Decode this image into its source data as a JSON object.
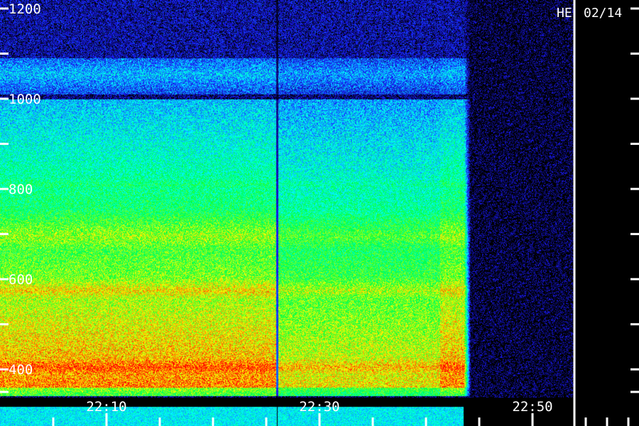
{
  "chart_data": {
    "type": "heatmap",
    "title": "",
    "station_label": "HE",
    "date_label": "02/14",
    "xlabel": "",
    "ylabel": "",
    "y_range": [
      350,
      1200
    ],
    "y_tick_labels": [
      {
        "value": 1200,
        "label": "1200"
      },
      {
        "value": 1000,
        "label": "1000"
      },
      {
        "value": 800,
        "label": "800"
      },
      {
        "value": 600,
        "label": "600"
      },
      {
        "value": 400,
        "label": "400"
      }
    ],
    "y_minor_ticks": [
      1100,
      900,
      700,
      500,
      350
    ],
    "x_tick_labels": [
      {
        "value": "22:10",
        "label": "22:10"
      },
      {
        "value": "22:30",
        "label": "22:30"
      },
      {
        "value": "22:50",
        "label": "22:50"
      }
    ],
    "x_time_range": [
      "22:00",
      "22:55"
    ],
    "x_minor_ticks": [
      "22:05",
      "22:15",
      "22:20",
      "22:25",
      "22:35",
      "22:40",
      "22:45"
    ],
    "data_gap_time": "22:26",
    "emission_end_time": "22:43",
    "colormap": [
      "#000000",
      "#1a1aff",
      "#00ffff",
      "#00ff3c",
      "#ffff00",
      "#ff0000"
    ],
    "bands": [
      {
        "f_low": 1030,
        "f_high": 1080,
        "level": 0.35
      },
      {
        "f_low": 870,
        "f_high": 930,
        "level": 0.45
      },
      {
        "f_low": 770,
        "f_high": 850,
        "level": 0.55
      },
      {
        "f_low": 620,
        "f_high": 770,
        "level": 0.72
      },
      {
        "f_low": 530,
        "f_high": 620,
        "level": 0.82
      },
      {
        "f_low": 360,
        "f_high": 450,
        "level": 0.95
      }
    ],
    "right_edge_separator_color": "#ffffff"
  }
}
